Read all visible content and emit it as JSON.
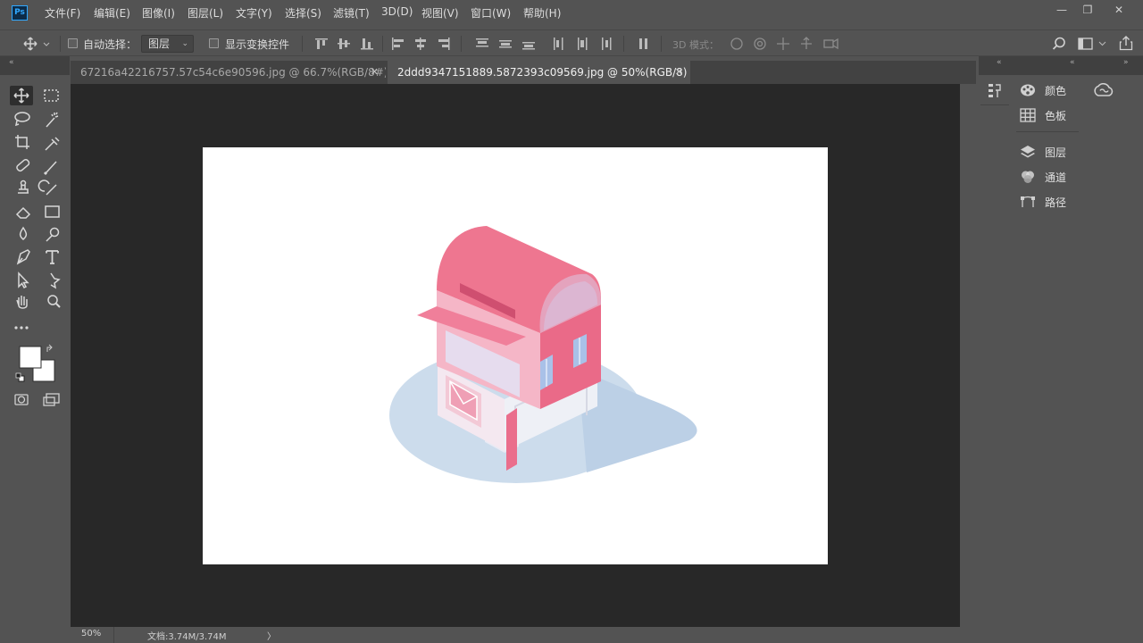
{
  "app": {
    "logo": "Ps"
  },
  "menu": [
    "文件(F)",
    "编辑(E)",
    "图像(I)",
    "图层(L)",
    "文字(Y)",
    "选择(S)",
    "滤镜(T)",
    "3D(D)",
    "视图(V)",
    "窗口(W)",
    "帮助(H)"
  ],
  "window_controls": {
    "minimize": "—",
    "restore": "❐",
    "close": "✕"
  },
  "options": {
    "auto_select_label": "自动选择：",
    "auto_select_checked": false,
    "layer_select_value": "图层",
    "show_transform_label": "显示变换控件",
    "show_transform_checked": false,
    "mode_3d_label": "3D 模式："
  },
  "tabs": [
    {
      "label": "67216a42216757.57c54c6e90596.jpg @ 66.7%(RGB/8#) *",
      "close": "✕",
      "active": false
    },
    {
      "label": "2ddd9347151889.5872393c09569.jpg @ 50%(RGB/8) *",
      "close": "✕",
      "active": true
    }
  ],
  "status": {
    "zoom": "50%",
    "doc_size": "文档:3.74M/3.74M",
    "arrow": "〉"
  },
  "panels": {
    "group1": [
      {
        "label": "颜色",
        "icon": "palette-icon"
      },
      {
        "label": "色板",
        "icon": "grid-icon"
      }
    ],
    "group2": [
      {
        "label": "图层",
        "icon": "layers-icon"
      },
      {
        "label": "通道",
        "icon": "channels-icon"
      },
      {
        "label": "路径",
        "icon": "paths-icon"
      }
    ]
  },
  "colors": {
    "foreground": "#ffffff",
    "background": "#ffffff",
    "mailbox_pink": "#ee6f8a",
    "shadow_blue": "#c2d3e6"
  },
  "tools": [
    "move-tool",
    "marquee-tool",
    "lasso-tool",
    "magic-wand-tool",
    "crop-tool",
    "eyedropper-tool",
    "healing-tool",
    "brush-tool",
    "stamp-tool",
    "history-brush-tool",
    "eraser-tool",
    "gradient-tool",
    "blur-tool",
    "dodge-tool",
    "pen-tool",
    "type-tool",
    "path-select-tool",
    "shape-tool",
    "hand-tool",
    "zoom-tool",
    "more-tools"
  ]
}
